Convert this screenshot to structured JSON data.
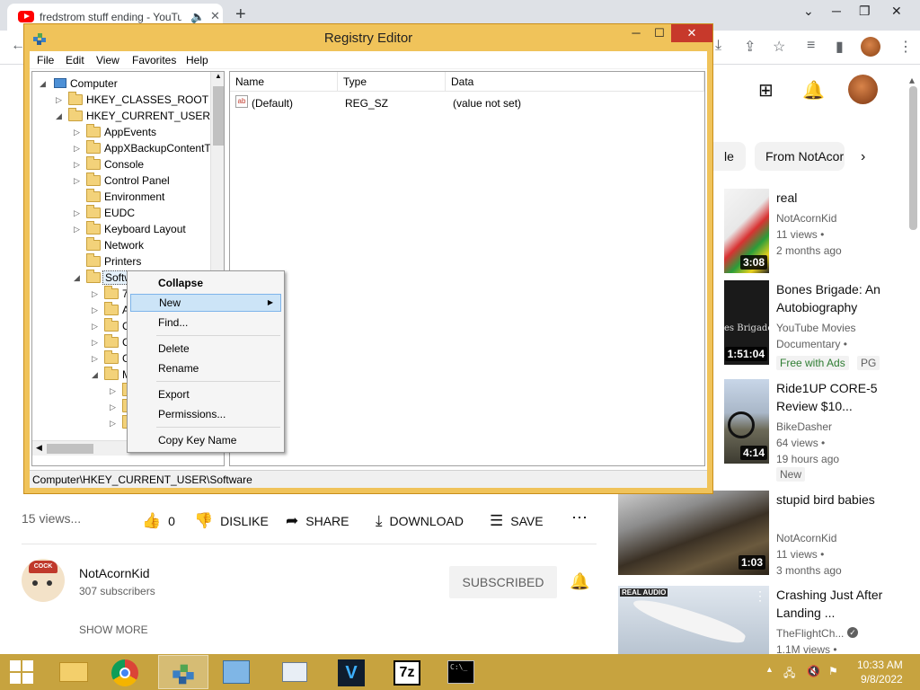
{
  "browser": {
    "tab_title": "fredstrom stuff ending - YouTube",
    "new_tab": "+",
    "minimize": "─",
    "restore": "❐",
    "close": "✕"
  },
  "youtube": {
    "chips": [
      "le",
      "From NotAcornKid"
    ],
    "views": "15 views...",
    "actions": {
      "likes": "0",
      "dislike": "DISLIKE",
      "share": "SHARE",
      "download": "DOWNLOAD",
      "save": "SAVE",
      "more": "⋯"
    },
    "channel": {
      "name": "NotAcornKid",
      "subscribers": "307 subscribers",
      "subscribe_label": "SUBSCRIBED",
      "show_more": "SHOW MORE",
      "avatar_text": "COCK"
    },
    "recommendations": [
      {
        "title": "real",
        "channel": "NotAcornKid",
        "views": "11 views •",
        "age": "2 months ago",
        "duration": "3:08"
      },
      {
        "title": "Bones Brigade: An Autobiography",
        "channel": "YouTube Movies",
        "views": "Documentary •",
        "age": "",
        "duration": "1:51:04",
        "badge": "Free with Ads",
        "rating": "PG",
        "thumb_text": "es Brigade"
      },
      {
        "title": "Ride1UP CORE-5 Review $10...",
        "channel": "BikeDasher",
        "views": "64 views •",
        "age": "19 hours ago",
        "duration": "4:14",
        "badge": "New"
      },
      {
        "title": "stupid bird babies",
        "channel": "NotAcornKid",
        "views": "11 views •",
        "age": "3 months ago",
        "duration": "1:03"
      },
      {
        "title": "Crashing Just After Landing ...",
        "channel": "TheFlightCh...",
        "views": "1.1M views •",
        "age": "",
        "duration": "",
        "thumb_text": "REAL AUDIO"
      }
    ]
  },
  "regedit": {
    "title": "Registry Editor",
    "menu": [
      "File",
      "Edit",
      "View",
      "Favorites",
      "Help"
    ],
    "tree": {
      "root": "Computer",
      "hkcr": "HKEY_CLASSES_ROOT",
      "hkcu": "HKEY_CURRENT_USER",
      "children": [
        "AppEvents",
        "AppXBackupContentType",
        "Console",
        "Control Panel",
        "Environment",
        "EUDC",
        "Keyboard Layout",
        "Network",
        "Printers"
      ],
      "selected": "Software",
      "sub_partial": [
        "7",
        "A",
        "C",
        "C",
        "G",
        "M"
      ]
    },
    "columns": [
      "Name",
      "Type",
      "Data"
    ],
    "values": [
      {
        "name": "(Default)",
        "type": "REG_SZ",
        "data": "(value not set)"
      }
    ],
    "status": "Computer\\HKEY_CURRENT_USER\\Software",
    "context_menu": {
      "collapse": "Collapse",
      "new": "New",
      "find": "Find...",
      "delete": "Delete",
      "rename": "Rename",
      "export": "Export",
      "permissions": "Permissions...",
      "copy_key": "Copy Key Name"
    }
  },
  "taskbar": {
    "time": "10:33 AM",
    "date": "9/8/2022",
    "apps": [
      "start-button",
      "file-explorer",
      "chrome",
      "registry-editor",
      "control-panel",
      "performance-monitor",
      "veracrypt",
      "7-zip",
      "command-prompt"
    ],
    "vc_label": "V",
    "sevenzip_label": "7z",
    "cmd_label": "C:\\_"
  },
  "colors": {
    "window_frame": "#f0c35a",
    "taskbar": "#c7a33f",
    "close_button": "#c7392b",
    "menu_highlight": "#cce4f7",
    "youtube_red": "#ff0000"
  }
}
